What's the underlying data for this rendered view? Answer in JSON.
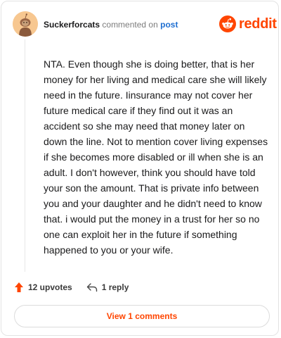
{
  "header": {
    "username": "Suckerforcats",
    "action_text": "commented on",
    "post_link": "post",
    "logo_text": "reddit"
  },
  "comment": {
    "body": "NTA. Even though she is doing better, that is her money for her living and medical care she will likely need in the future. Iinsurance may not cover her future medical care if they find out it was an accident so she may need that money later on down the line. Not to mention cover living expenses if she becomes more disabled or ill when she is an adult. I don't however, think you should have told your son the amount. That is private info between you and your daughter and he didn't need to know that. i would put the money in a trust for her so no one can exploit her in the future if something happened to you or your wife."
  },
  "actions": {
    "upvotes": "12 upvotes",
    "replies": "1 reply"
  },
  "footer": {
    "view_comments": "View 1 comments"
  },
  "icons": {
    "avatar": "snoo-avatar-icon",
    "logo": "reddit-logo-icon",
    "upvote": "upvote-arrow-icon",
    "reply": "reply-arrow-icon"
  },
  "colors": {
    "brand": "#ff4500",
    "link": "#1f6fd1",
    "avatar_bg": "#f7c790"
  }
}
